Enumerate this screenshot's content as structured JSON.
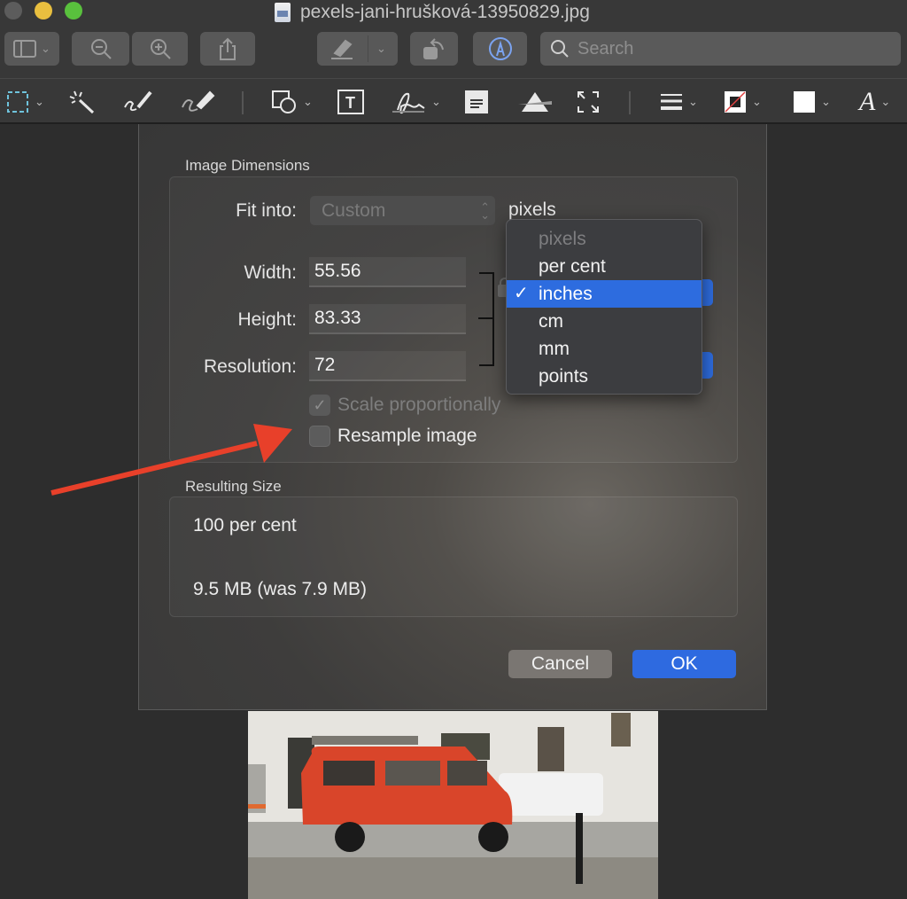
{
  "window": {
    "title": "pexels-jani-hrušková-13950829.jpg",
    "file_icon": "image-file-icon"
  },
  "toolbar": {
    "buttons": [
      {
        "name": "sidebar-toggle",
        "icon": "sidebar-icon"
      },
      {
        "name": "zoom-out",
        "icon": "zoom-out-icon"
      },
      {
        "name": "zoom-in",
        "icon": "zoom-in-icon"
      },
      {
        "name": "share",
        "icon": "share-icon"
      },
      {
        "name": "highlight",
        "icon": "highlighter-icon"
      },
      {
        "name": "rotate",
        "icon": "rotate-icon"
      },
      {
        "name": "markup",
        "icon": "markup-pen-icon"
      }
    ],
    "search": {
      "placeholder": "Search",
      "value": ""
    }
  },
  "markup_toolbar": {
    "tools": [
      "selection-rect-icon",
      "instant-alpha-icon",
      "sketch-icon",
      "draw-icon",
      "shapes-icon",
      "text-icon",
      "sign-icon",
      "note-icon",
      "adjust-color-icon",
      "adjust-size-icon",
      "line-style-icon",
      "border-color-icon",
      "fill-color-icon",
      "text-style-icon"
    ]
  },
  "dialog": {
    "image_dimensions_label": "Image Dimensions",
    "fit_into_label": "Fit into:",
    "fit_into_value": "Custom",
    "unit_label": "pixels",
    "width_label": "Width:",
    "width_value": "55.56",
    "height_label": "Height:",
    "height_value": "83.33",
    "resolution_label": "Resolution:",
    "resolution_value": "72",
    "scale_proportionally_label": "Scale proportionally",
    "scale_proportionally_checked": true,
    "resample_label": "Resample image",
    "resample_checked": false,
    "resulting_size_label": "Resulting Size",
    "result_percent": "100 per cent",
    "result_size": "9.5 MB (was 7.9 MB)",
    "cancel_label": "Cancel",
    "ok_label": "OK"
  },
  "unit_menu": {
    "items": [
      {
        "label": "pixels",
        "disabled": true
      },
      {
        "label": "per cent"
      },
      {
        "label": "inches",
        "selected": true
      },
      {
        "label": "cm"
      },
      {
        "label": "mm"
      },
      {
        "label": "points"
      }
    ],
    "check_glyph": "✓"
  },
  "annotation": {
    "type": "arrow",
    "color": "#e8402a",
    "points_to": "Resample image"
  },
  "colors": {
    "accent": "#2e6ae0",
    "annotation_red": "#e8402a",
    "traffic_yellow": "#e9bf3f",
    "traffic_green": "#59c13d"
  }
}
